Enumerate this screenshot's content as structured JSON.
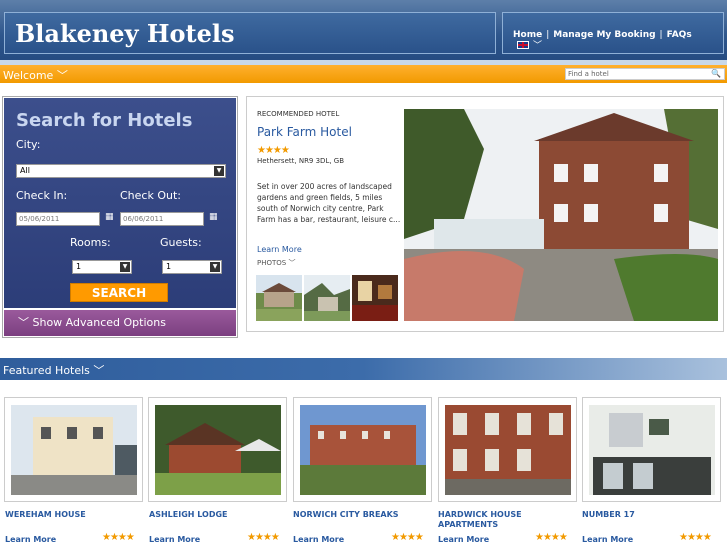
{
  "header": {
    "logo": "Blakeney Hotels",
    "nav": [
      "Home",
      "Manage My Booking",
      "FAQs"
    ]
  },
  "welcome": {
    "label": "Welcome",
    "chevron": "﹀",
    "search_placeholder": "Find a hotel"
  },
  "search": {
    "title": "Search for Hotels",
    "city_label": "City:",
    "city_value": "All",
    "checkin_label": "Check In:",
    "checkout_label": "Check Out:",
    "checkin_value": "05/06/2011",
    "checkout_value": "06/06/2011",
    "rooms_label": "Rooms:",
    "guests_label": "Guests:",
    "rooms_value": "1",
    "guests_value": "1",
    "button": "SEARCH",
    "advanced": "Show Advanced Options"
  },
  "recommended": {
    "label": "RECOMMENDED HOTEL",
    "name": "Park Farm Hotel",
    "stars": "★★★★",
    "address": "Hethersett, NR9 3DL, GB",
    "description": "Set in over 200 acres of landscaped gardens and green fields, 5 miles south of Norwich city centre, Park Farm has a bar, restaurant, leisure c...",
    "learn_more": "Learn More",
    "photos": "PHOTOS"
  },
  "featured": {
    "title": "Featured Hotels",
    "hotels": [
      {
        "name": "WEREHAM HOUSE",
        "learn": "Learn More",
        "stars": "★★★★"
      },
      {
        "name": "ASHLEIGH LODGE",
        "learn": "Learn More",
        "stars": "★★★★"
      },
      {
        "name": "NORWICH CITY BREAKS",
        "learn": "Learn More",
        "stars": "★★★★"
      },
      {
        "name": "HARDWICK HOUSE APARTMENTS",
        "learn": "Learn More",
        "stars": "★★★★"
      },
      {
        "name": "NUMBER 17",
        "learn": "Learn More",
        "stars": "★★★★"
      }
    ]
  },
  "colors": {
    "brand_blue": "#2e568c",
    "accent_orange": "#f29a00",
    "link": "#2a5aa0"
  }
}
